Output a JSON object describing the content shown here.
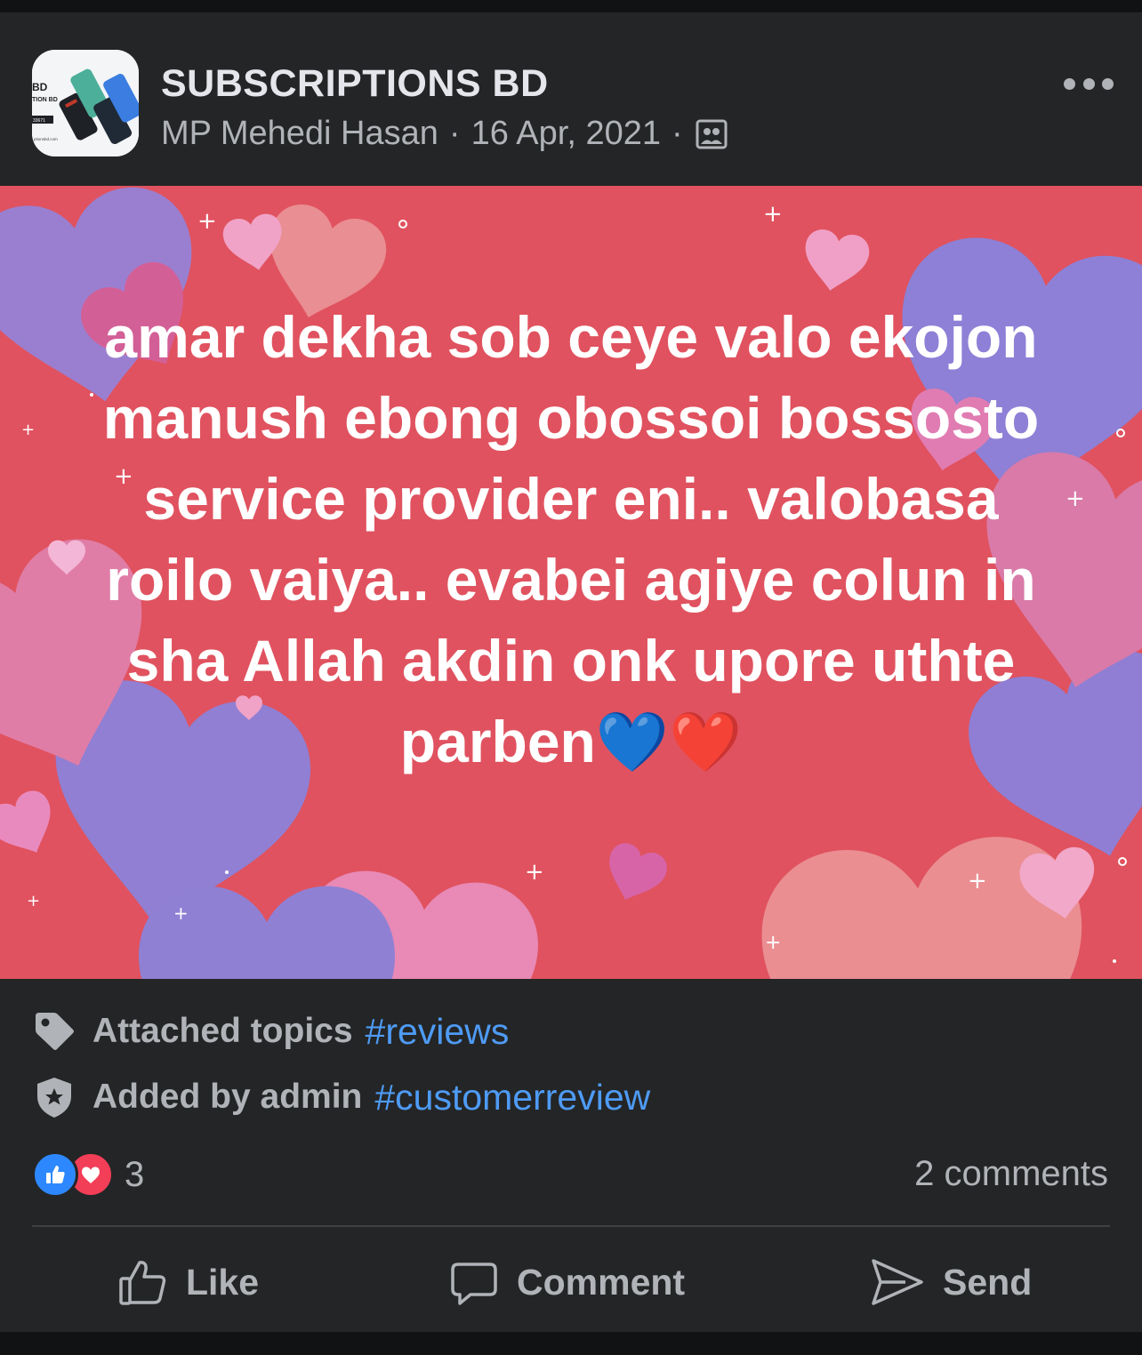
{
  "header": {
    "page_name": "SUBSCRIPTIONS BD",
    "author": "MP Mehedi Hasan",
    "separator": "·",
    "date": "16 Apr, 2021",
    "audience_icon": "group-icon",
    "more_icon": "more-options-icon"
  },
  "avatar": {
    "logo_text_1": "BD",
    "logo_text_2": "TION BD",
    "logo_text_3": "33671",
    "logo_text_4": "ptionsbd.com"
  },
  "post": {
    "text": "amar dekha sob ceye valo ekojon manush ebong obossoi bossosto service provider eni.. valobasa roilo vaiya.. evabei agiye colun in sha Allah akdin onk upore uthte parben💙❤️",
    "background_color": "#e0525f"
  },
  "topics": {
    "attached_label": "Attached topics",
    "attached_tag": "#reviews",
    "admin_label": "Added by admin",
    "admin_tag": "#customerreview"
  },
  "reactions": {
    "count": "3",
    "types": [
      "like",
      "love"
    ],
    "like_color": "#2d88ff",
    "love_color": "#f33e58"
  },
  "comments": {
    "label": "2 comments"
  },
  "actions": {
    "like": "Like",
    "comment": "Comment",
    "send": "Send"
  },
  "colors": {
    "card_bg": "#242526",
    "text_primary": "#e4e6eb",
    "text_secondary": "#b0b3b8",
    "link": "#4e9bf5"
  }
}
